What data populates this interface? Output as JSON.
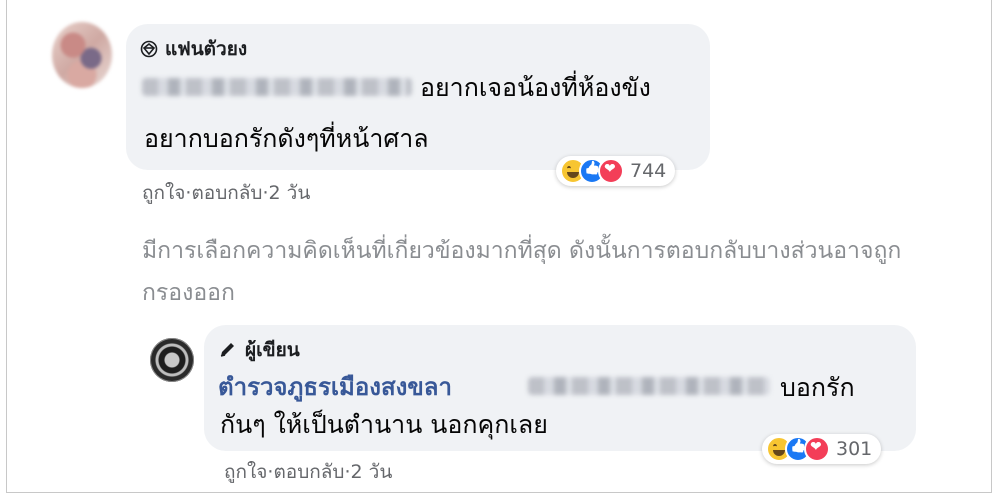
{
  "comment1": {
    "badge": "แฟนตัวยง",
    "text_line1": "อยากเจอน้องที่ห้องขัง",
    "text_line2": "อยากบอกรักดังๆที่หน้าศาล",
    "reaction_count": "744",
    "like_label": "ถูกใจ",
    "reply_label": "ตอบกลับ",
    "time": "2 วัน"
  },
  "filter_notice": "มีการเลือกความคิดเห็นที่เกี่ยวข้องมากที่สุด ดังนั้นการตอบกลับบางส่วนอาจถูกกรองออก",
  "reply1": {
    "badge": "ผู้เขียน",
    "author": "ตำรวจภูธรเมืองสงขลา",
    "text_line1": "บอกรัก",
    "text_line2": "กันๆ ให้เป็นตำนาน นอกคุกเลย",
    "reaction_count": "301",
    "like_label": "ถูกใจ",
    "reply_label": "ตอบกลับ",
    "time": "2 วัน"
  },
  "separator": " · ",
  "icons": [
    "diamond-icon",
    "pencil-icon",
    "haha-reaction-icon",
    "like-reaction-icon",
    "love-reaction-icon"
  ]
}
